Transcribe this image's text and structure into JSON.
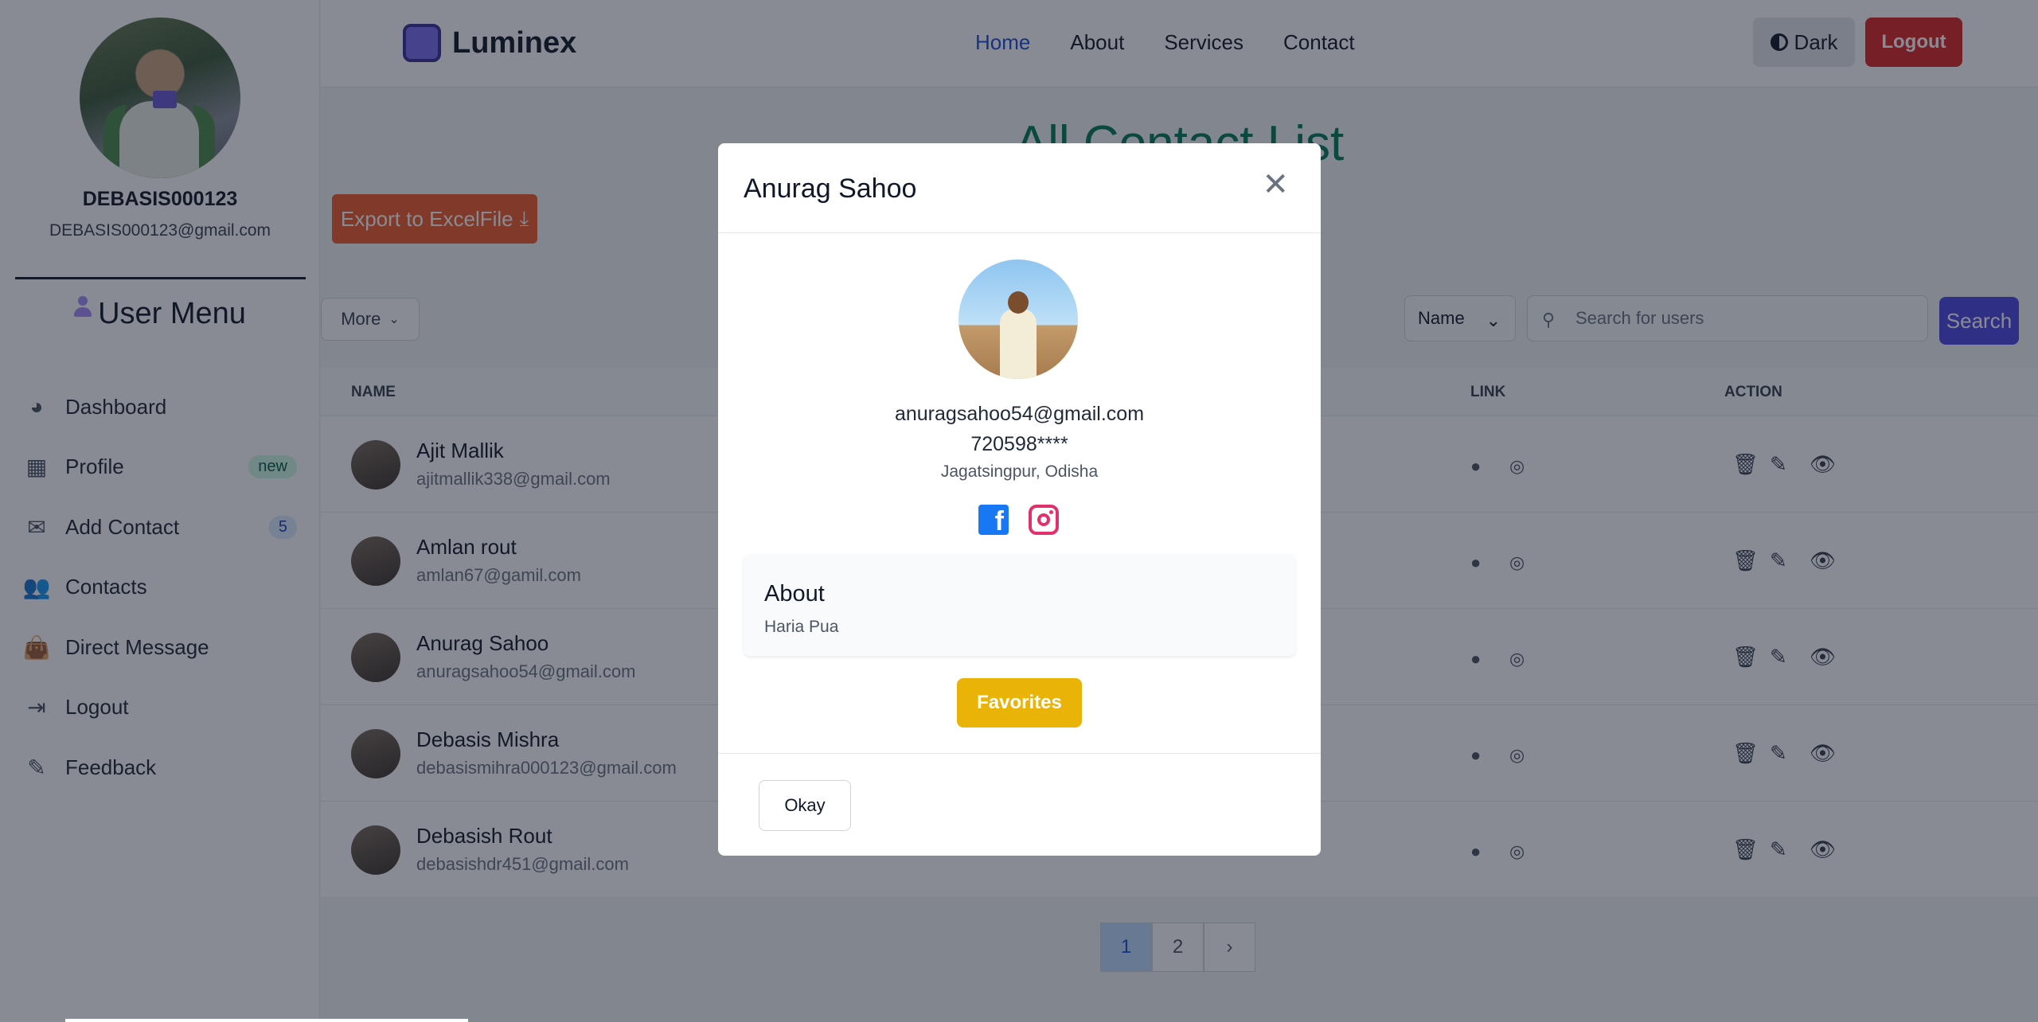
{
  "sidebar": {
    "username": "DEBASIS000123",
    "email": "DEBASIS000123@gmail.com",
    "menu_title": "User Menu",
    "items": [
      {
        "label": "Dashboard",
        "icon": "chart-pie-icon"
      },
      {
        "label": "Profile",
        "icon": "grid-icon",
        "badge": "new"
      },
      {
        "label": "Add Contact",
        "icon": "mailbox-icon",
        "badge": "5"
      },
      {
        "label": "Contacts",
        "icon": "users-icon"
      },
      {
        "label": "Direct Message",
        "icon": "bag-icon"
      },
      {
        "label": "Logout",
        "icon": "sign-in-icon"
      },
      {
        "label": "Feedback",
        "icon": "edit-icon"
      }
    ]
  },
  "header": {
    "logo": "Luminex",
    "nav": [
      "Home",
      "About",
      "Services",
      "Contact"
    ],
    "active_nav": "Home",
    "dark_label": "Dark",
    "logout_label": "Logout"
  },
  "main": {
    "title": "All Contact List",
    "export_label": "Export to ExcelFile",
    "more_label": "More",
    "filter_select": "Name",
    "search_placeholder": "Search for users",
    "search_button": "Search",
    "columns": [
      "Name",
      "Link",
      "Action"
    ],
    "rows": [
      {
        "name": "Ajit Mallik",
        "email": "ajitmallik338@gmail.com"
      },
      {
        "name": "Amlan rout",
        "email": "amlan67@gamil.com"
      },
      {
        "name": "Anurag Sahoo",
        "email": "anuragsahoo54@gmail.com"
      },
      {
        "name": "Debasis Mishra",
        "email": "debasismihra000123@gmail.com"
      },
      {
        "name": "Debasish Rout",
        "email": "debasishdr451@gmail.com"
      }
    ],
    "pagination": {
      "pages": [
        "1",
        "2"
      ],
      "current": "1"
    }
  },
  "modal": {
    "title": "Anurag Sahoo",
    "email": "anuragsahoo54@gmail.com",
    "phone": "720598****",
    "location": "Jagatsingpur, Odisha",
    "about_title": "About",
    "about_text": "Haria Pua",
    "favorites_label": "Favorites",
    "okay_label": "Okay"
  },
  "colors": {
    "brand": "#7c6cf0",
    "export": "#f05a2a",
    "logout": "#dc2626",
    "search": "#4f46e5",
    "favorites": "#eab308",
    "title": "#047857"
  }
}
